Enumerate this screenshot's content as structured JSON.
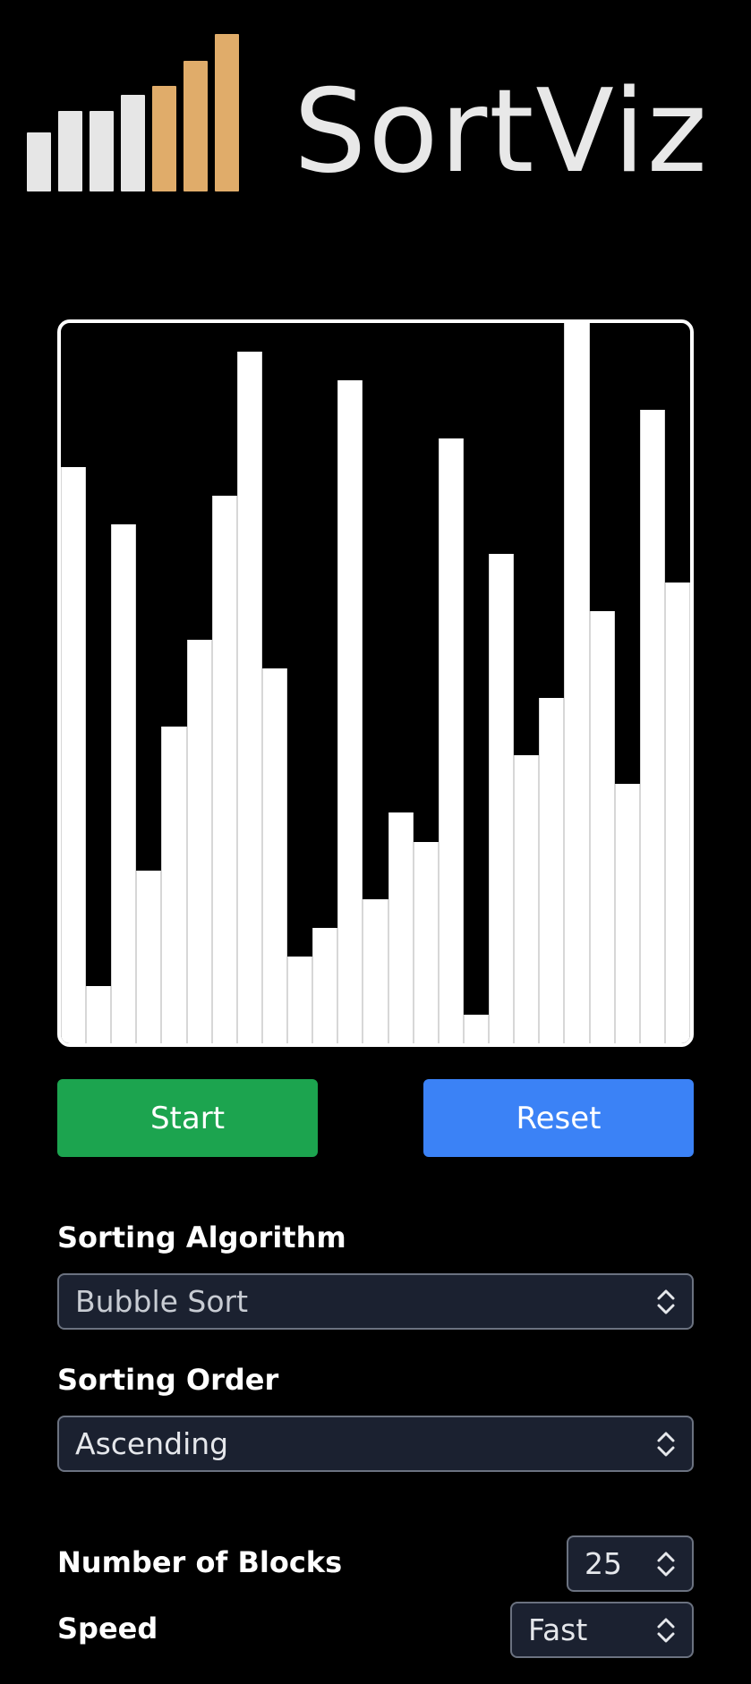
{
  "logo": {
    "text": "SortViz",
    "bar_colors": [
      "#e6e6e6",
      "#e6e6e6",
      "#e6e6e6",
      "#e6e6e6",
      "#e0ac6a",
      "#e0ac6a",
      "#e0ac6a"
    ]
  },
  "visualizer": {
    "values": [
      80,
      8,
      72,
      24,
      44,
      56,
      76,
      96,
      52,
      12,
      16,
      92,
      20,
      32,
      28,
      84,
      4,
      68,
      40,
      48,
      100,
      60,
      36,
      88,
      64
    ]
  },
  "buttons": {
    "start_label": "Start",
    "reset_label": "Reset",
    "start_color": "#1ca44f",
    "reset_color": "#3b82f6"
  },
  "controls": {
    "algorithm_label": "Sorting Algorithm",
    "algorithm_value": "Bubble Sort",
    "order_label": "Sorting Order",
    "order_value": "Ascending",
    "blocks_label": "Number of Blocks",
    "blocks_value": "25",
    "speed_label": "Speed",
    "speed_value": "Fast"
  },
  "icons": {
    "select_arrow": "chevron-up-down-icon"
  }
}
